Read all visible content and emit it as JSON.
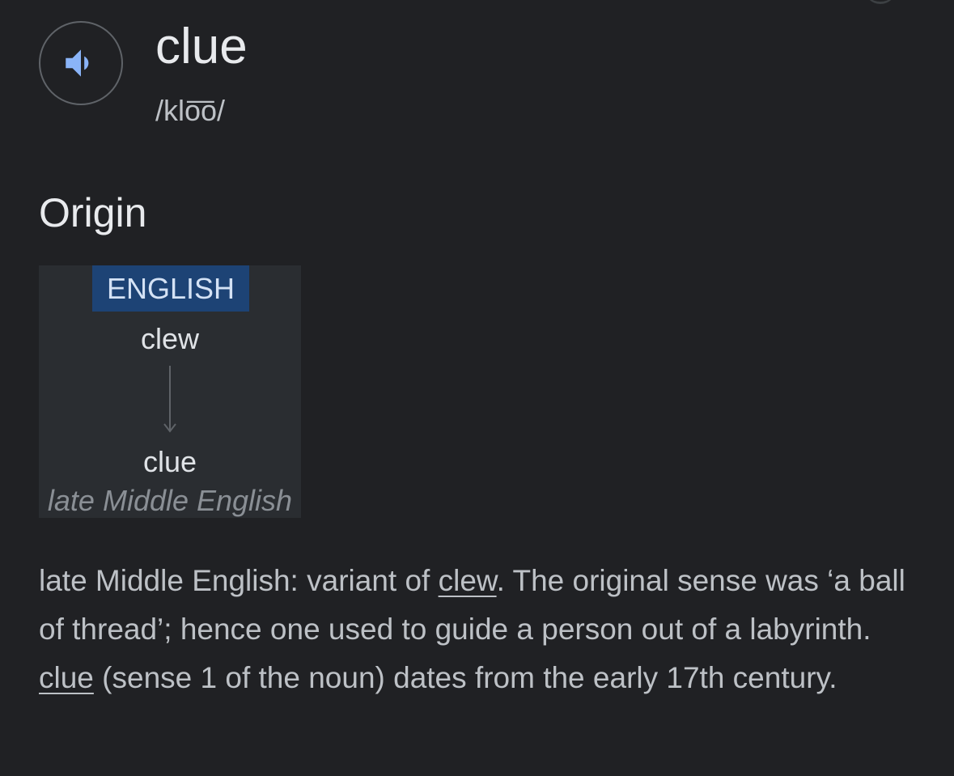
{
  "entry": {
    "word": "clue",
    "pronunciation": "/klo͞o/",
    "audio_icon": "speaker-icon",
    "accent_color": "#8ab4f8"
  },
  "origin": {
    "heading": "Origin",
    "diagram": {
      "language_label": "ENGLISH",
      "source_word": "clew",
      "target_word": "clue",
      "period": "late Middle English",
      "label_bg_color": "#1d4375",
      "arrow_icon": "arrow-down-icon"
    },
    "text": {
      "part1": "late Middle English: variant of ",
      "link1": "clew",
      "part2": ". The original sense was ‘a ball of thread’; hence one used to guide a person out of a labyrinth. ",
      "link2": "clue",
      "part3": " (sense 1 of the noun) dates from the early 17th century."
    }
  }
}
